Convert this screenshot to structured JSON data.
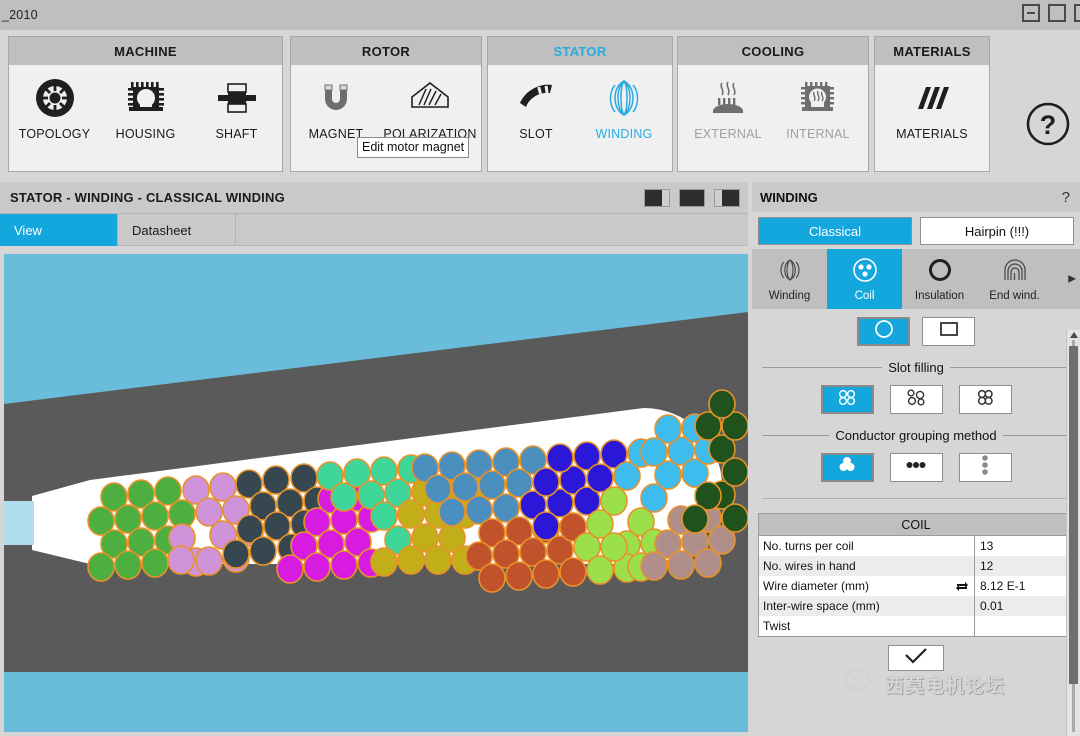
{
  "window": {
    "title": "_2010",
    "controls": [
      {
        "name": "minimize-button",
        "glyph": "minimize"
      },
      {
        "name": "maximize-button",
        "glyph": "maximize"
      },
      {
        "name": "close-button",
        "glyph": "close"
      }
    ]
  },
  "ribbon": {
    "groups": [
      {
        "title": "MACHINE",
        "active": false,
        "items": [
          {
            "label": "TOPOLOGY",
            "icon": "topology-icon",
            "state": "normal"
          },
          {
            "label": "HOUSING",
            "icon": "housing-icon",
            "state": "normal"
          },
          {
            "label": "SHAFT",
            "icon": "shaft-icon",
            "state": "normal"
          }
        ]
      },
      {
        "title": "ROTOR",
        "active": false,
        "items": [
          {
            "label": "MAGNET",
            "icon": "magnet-icon",
            "state": "dim"
          },
          {
            "label": "POLARIZATION",
            "icon": "polarization-icon",
            "state": "normal"
          }
        ]
      },
      {
        "title": "STATOR",
        "active": true,
        "items": [
          {
            "label": "SLOT",
            "icon": "slot-icon",
            "state": "normal"
          },
          {
            "label": "WINDING",
            "icon": "winding-icon",
            "state": "selected"
          }
        ]
      },
      {
        "title": "COOLING",
        "active": false,
        "items": [
          {
            "label": "EXTERNAL",
            "icon": "external-cooling-icon",
            "state": "dim"
          },
          {
            "label": "INTERNAL",
            "icon": "internal-cooling-icon",
            "state": "dim"
          }
        ]
      },
      {
        "title": "MATERIALS",
        "active": false,
        "items": [
          {
            "label": "MATERIALS",
            "icon": "materials-icon",
            "state": "normal"
          }
        ]
      }
    ],
    "help_icon": "help-icon",
    "tooltip": "Edit motor magnet"
  },
  "document": {
    "title": "STATOR - WINDING - CLASSICAL WINDING",
    "layout_buttons": [
      {
        "name": "layout-left-split",
        "mode": "left"
      },
      {
        "name": "layout-single",
        "mode": "single"
      },
      {
        "name": "layout-right-split",
        "mode": "right"
      }
    ],
    "tabs": [
      {
        "label": "View",
        "active": true
      },
      {
        "label": "Datasheet",
        "active": false
      }
    ]
  },
  "properties": {
    "title": "WINDING",
    "help": "?",
    "winding_type": [
      {
        "label": "Classical",
        "active": true
      },
      {
        "label": "Hairpin (!!!)",
        "active": false
      }
    ],
    "sub_tabs": [
      {
        "label": "Winding",
        "icon": "winding-coil-icon",
        "active": false
      },
      {
        "label": "Coil",
        "icon": "coil-section-icon",
        "active": true
      },
      {
        "label": "Insulation",
        "icon": "insulation-ring-icon",
        "active": false
      },
      {
        "label": "End wind.",
        "icon": "end-winding-icon",
        "active": false
      }
    ],
    "sub_tabs_more": "more-tabs-arrow-icon",
    "conductor_shape": [
      {
        "name": "round-conductor",
        "icon": "circle-icon",
        "active": true
      },
      {
        "name": "rectangular-conductor",
        "icon": "square-icon",
        "active": false
      }
    ],
    "slot_filling": {
      "label": "Slot filling",
      "options": [
        {
          "name": "aligned-filling",
          "icon": "aligned-circles-icon",
          "active": true
        },
        {
          "name": "staggered-filling",
          "icon": "staggered-circles-icon",
          "active": false
        },
        {
          "name": "compact-filling",
          "icon": "compact-circles-icon",
          "active": false
        }
      ]
    },
    "conductor_grouping": {
      "label": "Conductor grouping method",
      "options": [
        {
          "name": "cluster-grouping",
          "icon": "cluster-dots-icon",
          "active": true
        },
        {
          "name": "horizontal-grouping",
          "icon": "horizontal-dots-icon",
          "active": false
        },
        {
          "name": "vertical-grouping",
          "icon": "vertical-dots-icon",
          "active": false
        }
      ]
    },
    "coil_table": {
      "caption": "COIL",
      "rows": [
        {
          "key": "No. turns per coil",
          "value": "13",
          "icon": null
        },
        {
          "key": "No. wires in hand",
          "value": "12",
          "icon": null
        },
        {
          "key": "Wire diameter (mm)",
          "value": "8.12 E-1",
          "icon": "link-icon"
        },
        {
          "key": "Inter-wire space (mm)",
          "value": "0.01",
          "icon": null
        },
        {
          "key": "Twist",
          "value": "",
          "icon": null
        }
      ]
    },
    "validate_button": {
      "name": "validate-button",
      "icon": "checkmark-icon"
    }
  },
  "watermark": {
    "text": "西莫电机论坛",
    "icon": "wechat-icon"
  },
  "colors": {
    "accent": "#13A7DD",
    "viewport_bg": "#69BDDA",
    "stator_iron": "#5A5A5A",
    "slot_fill": "#FFFFFF",
    "wedge": "#B0DCEC",
    "conductor_outline": "#E8922A",
    "chrome": "#D6D6D6",
    "titlebar": "#BFBFBF"
  },
  "slot_view": {
    "description": "Classical winding slot cross-section with grouped round conductors",
    "conductor_groups": [
      {
        "order": 1,
        "color": "#4CAF3F",
        "name": "group-green"
      },
      {
        "order": 2,
        "color": "#CE93D8",
        "name": "group-light-purple"
      },
      {
        "order": 3,
        "color": "#37474F",
        "name": "group-dark-slate"
      },
      {
        "order": 4,
        "color": "#D81BE0",
        "name": "group-magenta"
      },
      {
        "order": 5,
        "color": "#3FD69A",
        "name": "group-spring-green"
      },
      {
        "order": 6,
        "color": "#C2AE18",
        "name": "group-olive"
      },
      {
        "order": 7,
        "color": "#4B8FBF",
        "name": "group-steel-blue"
      },
      {
        "order": 8,
        "color": "#C0522C",
        "name": "group-rust"
      },
      {
        "order": 9,
        "color": "#2B17D8",
        "name": "group-indigo"
      },
      {
        "order": 10,
        "color": "#9BE04A",
        "name": "group-lime"
      },
      {
        "order": 11,
        "color": "#3FBCEE",
        "name": "group-sky-blue"
      },
      {
        "order": 12,
        "color": "#B08F8A",
        "name": "group-mauve"
      },
      {
        "order": 13,
        "color": "#20521D",
        "name": "group-dark-green"
      }
    ]
  }
}
